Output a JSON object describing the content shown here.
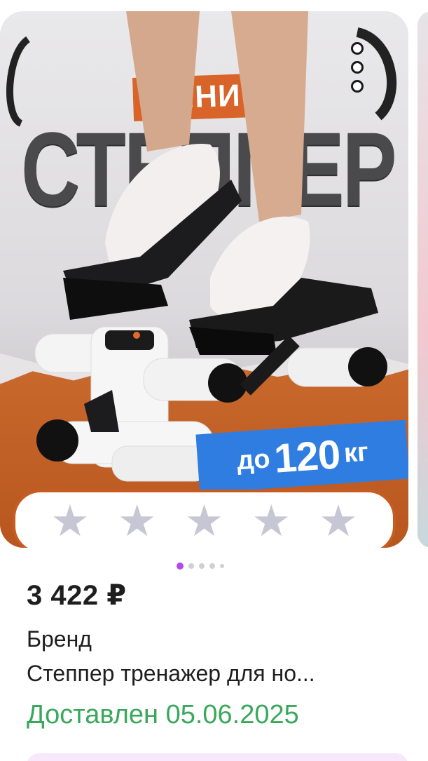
{
  "product": {
    "image": {
      "badge_top": "МИНИ",
      "big_title": "СТЕППЕР",
      "weight_prefix": "до",
      "weight_value": "120",
      "weight_unit": "кг"
    },
    "rating": {
      "stars_total": 5,
      "stars_filled": 0,
      "star_color": "#c7c6d4"
    },
    "pager": {
      "total": 5,
      "active_index": 0,
      "active_color": "#b04be8"
    },
    "price": "3 422 ₽",
    "brand": "Бренд",
    "title": "Степпер тренажер для но...",
    "delivery": "Доставлен 05.06.2025",
    "colors": {
      "accent_orange": "#d9642a",
      "badge_blue": "#2f7de0",
      "delivery_green": "#3aa85a"
    }
  }
}
